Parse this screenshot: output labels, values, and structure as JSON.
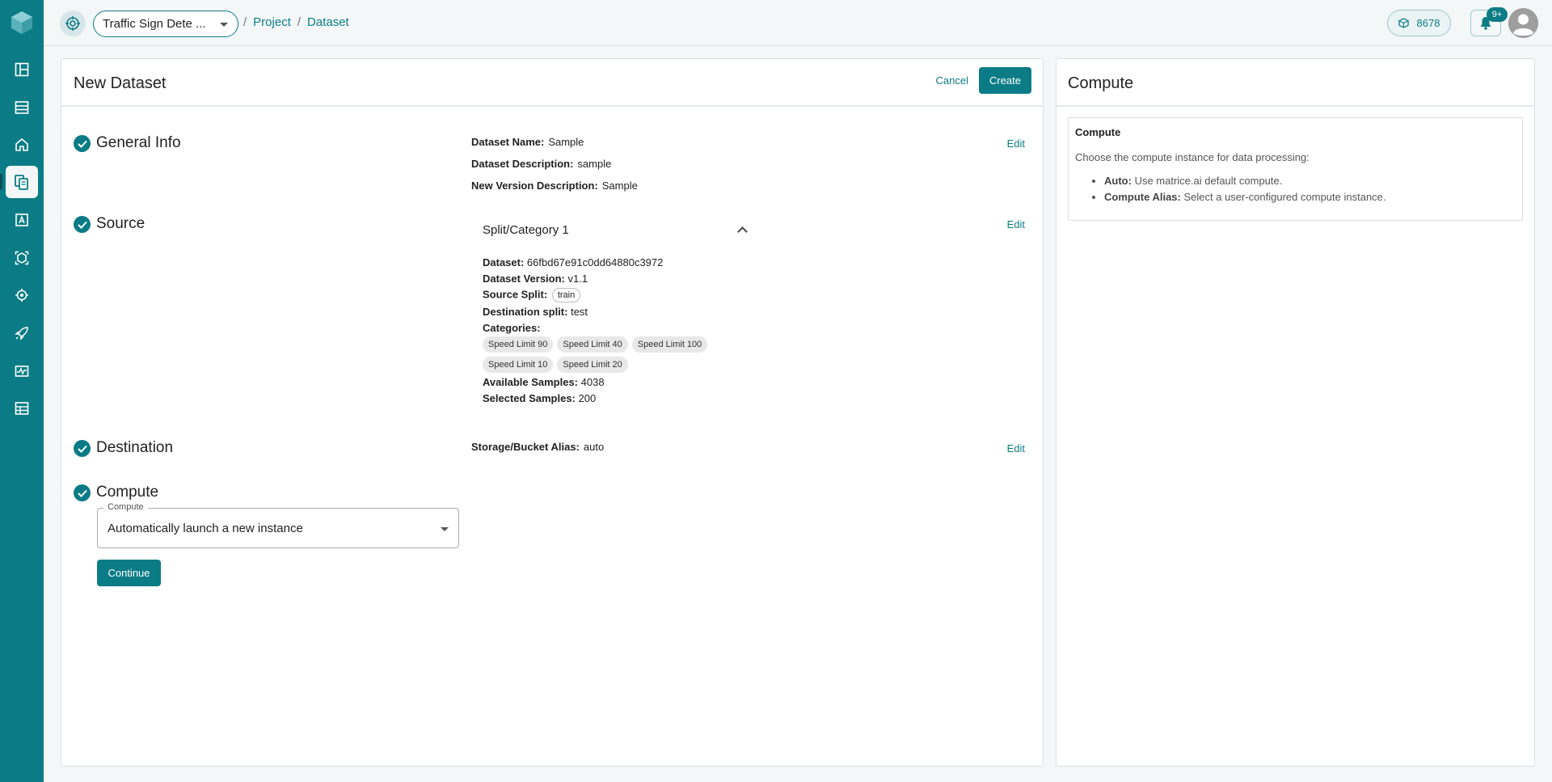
{
  "topbar": {
    "project_name": "Traffic Sign Dete ...",
    "breadcrumb_sep1": "/",
    "breadcrumb_project": "Project",
    "breadcrumb_sep2": "/",
    "breadcrumb_dataset": "Dataset",
    "credits": "8678",
    "notification_badge": "9+"
  },
  "panel": {
    "title": "New Dataset",
    "cancel_label": "Cancel",
    "create_label": "Create"
  },
  "steps": {
    "general": {
      "title": "General Info",
      "edit_label": "Edit",
      "dataset_name_label": "Dataset Name:",
      "dataset_name_value": "Sample",
      "dataset_desc_label": "Dataset Description:",
      "dataset_desc_value": "sample",
      "version_desc_label": "New Version Description:",
      "version_desc_value": "Sample"
    },
    "source": {
      "title": "Source",
      "edit_label": "Edit",
      "split_header": "Split/Category 1",
      "dataset_label": "Dataset:",
      "dataset_value": "66fbd67e91c0dd64880c3972",
      "version_label": "Dataset Version:",
      "version_value": "v1.1",
      "source_split_label": "Source Split:",
      "source_split_value": "train",
      "dest_split_label": "Destination split:",
      "dest_split_value": "test",
      "categories_label": "Categories:",
      "categories": [
        "Speed Limit 90",
        "Speed Limit 40",
        "Speed Limit 100",
        "Speed Limit 10",
        "Speed Limit 20"
      ],
      "available_label": "Available Samples:",
      "available_value": "4038",
      "selected_label": "Selected Samples:",
      "selected_value": "200"
    },
    "destination": {
      "title": "Destination",
      "edit_label": "Edit",
      "storage_label": "Storage/Bucket Alias:",
      "storage_value": "auto"
    },
    "compute": {
      "title": "Compute",
      "field_label": "Compute",
      "field_value": "Automatically launch a new instance",
      "continue_label": "Continue"
    }
  },
  "side_panel": {
    "title": "Compute",
    "box_title": "Compute",
    "description": "Choose the compute instance for data processing:",
    "items": [
      {
        "term": "Auto:",
        "text": "Use matrice.ai default compute."
      },
      {
        "term": "Compute Alias:",
        "text": "Select a user-configured compute instance."
      }
    ]
  },
  "colors": {
    "accent": "#0b7c86",
    "sidebar": "#0b7c86",
    "background": "#f3f7f8"
  },
  "icons": [
    "app-logo-icon",
    "dashboard-icon",
    "datasets-icon",
    "home-icon",
    "copy-icon",
    "annotation-icon",
    "model-icon",
    "settings-icon",
    "rocket-icon",
    "monitor-icon",
    "table-icon",
    "project-icon",
    "cube-icon",
    "bell-icon",
    "avatar-icon"
  ]
}
